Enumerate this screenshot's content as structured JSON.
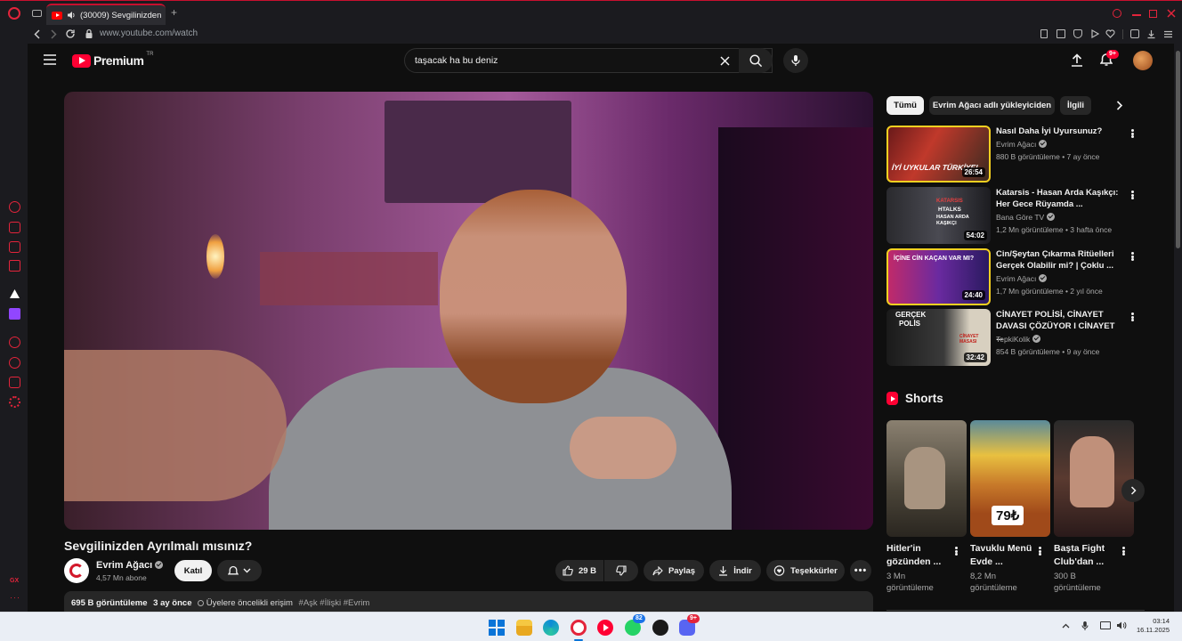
{
  "browser": {
    "tab_title": "(30009) Sevgilinizden",
    "url": "www.youtube.com/watch",
    "notification_count": "9+"
  },
  "youtube": {
    "logo_text": "Premium",
    "logo_region": "TR",
    "search_value": "taşacak ha bu deniz"
  },
  "video": {
    "title": "Sevgilinizden Ayrılmalı mısınız?",
    "channel": "Evrim Ağacı",
    "subscribers": "4,57 Mn abone",
    "join_label": "Katıl",
    "likes": "29 B",
    "share_label": "Paylaş",
    "download_label": "İndir",
    "thanks_label": "Teşekkürler",
    "views": "695 B görüntüleme",
    "age": "3 ay önce",
    "members_text": "Üyelere öncelikli erişim",
    "hashtags": "#Aşk #İlişki #Evrim"
  },
  "filters": {
    "chips": [
      "Tümü",
      "Evrim Ağacı adlı yükleyiciden",
      "İlgili"
    ]
  },
  "recommendations": [
    {
      "title": "Nasıl Daha İyi Uyursunuz?",
      "channel": "Evrim Ağacı",
      "meta": "880 B görüntüleme • 7 ay önce",
      "duration": "26:54"
    },
    {
      "title": "Katarsis - Hasan Arda Kaşıkçı: Her Gece Rüyamda ...",
      "channel": "Bana Göre TV",
      "meta": "1,2 Mn görüntüleme • 3 hafta önce",
      "duration": "54:02"
    },
    {
      "title": "Cin/Şeytan Çıkarma Ritüelleri Gerçek Olabilir mi? | Çoklu ...",
      "channel": "Evrim Ağacı",
      "meta": "1,7 Mn görüntüleme • 2 yıl önce",
      "duration": "24:40"
    },
    {
      "title": "CİNAYET POLİSİ, CİNAYET DAVASI ÇÖZÜYOR I CİNAYET ...",
      "channel": "TepkiKolik",
      "meta": "854 B görüntüleme • 9 ay önce",
      "duration": "32:42"
    }
  ],
  "thumb_text": {
    "rec1": "İYİ UYKULAR TÜRKİYE!",
    "rec2_a": "KATARSIS",
    "rec2_b": "HTALKS",
    "rec2_c": "HASAN ARDA KAŞIKÇI",
    "rec3": "İÇİNE CİN KAÇAN VAR MI?",
    "rec4_a": "GERÇEK",
    "rec4_b": "POLİS",
    "rec4_c": "CİNAYET MASASI",
    "short2_price": "79₺"
  },
  "shorts": {
    "heading": "Shorts",
    "items": [
      {
        "title": "Hitler'in gözünden ...",
        "views": "3 Mn görüntüleme"
      },
      {
        "title": "Tavuklu Menü Evde ...",
        "views": "8,2 Mn görüntüleme"
      },
      {
        "title": "Başta Fight Club'dan ...",
        "views": "300 B görüntüleme"
      }
    ]
  },
  "taskbar": {
    "time": "03:14",
    "date": "16.11.2025",
    "whatsapp_badge": "82",
    "discord_badge": "9+"
  },
  "opera_sidebar_label": "GX"
}
